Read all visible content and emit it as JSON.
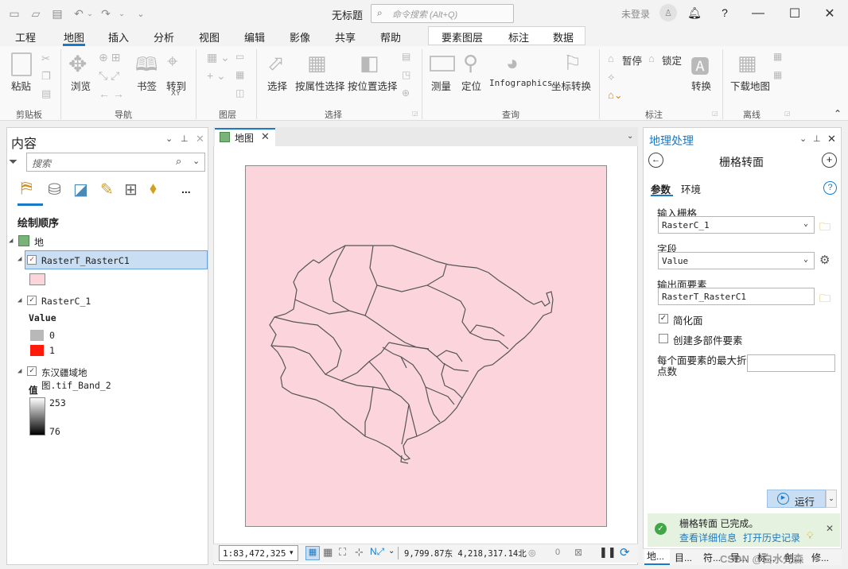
{
  "app": {
    "title": "无标题",
    "search_placeholder": "命令搜索 (Alt+Q)",
    "login": "未登录",
    "help": "?"
  },
  "ribbon_tabs": [
    "工程",
    "地图",
    "插入",
    "分析",
    "视图",
    "编辑",
    "影像",
    "共享",
    "帮助"
  ],
  "context_tabs": [
    "要素图层",
    "标注",
    "数据"
  ],
  "ribbon": {
    "paste": "粘贴",
    "browse": "浏览",
    "bookmarks": "书签",
    "goto": "转到",
    "goto_sub": "XY",
    "select": "选择",
    "select_attr": "按属性选择",
    "select_loc": "按位置选择",
    "measure": "测量",
    "locate": "定位",
    "infographics": "Infographics",
    "coord": "坐标转换",
    "pause": "暂停",
    "lock": "锁定",
    "convert": "转换",
    "download": "下载地图",
    "groups": [
      "剪贴板",
      "导航",
      "图层",
      "选择",
      "查询",
      "标注",
      "离线"
    ]
  },
  "contents": {
    "title": "内容",
    "search_placeholder": "搜索",
    "drawing_order": "绘制顺序",
    "map": "地图",
    "layer1": "RasterT_RasterC1",
    "layer2": "RasterC_1",
    "value_hdr": "Value",
    "v0": "0",
    "v1": "1",
    "layer3": "东汉疆域地图.tif_Band_2",
    "val_hdr": "值",
    "high": "253",
    "low": "76",
    "more": "..."
  },
  "map_tab": {
    "label": "地图"
  },
  "status": {
    "scale": "1:83,472,325",
    "coords": "9,799.87东 4,218,317.14北",
    "sel": "0"
  },
  "geoprocessing": {
    "title": "地理处理",
    "tool": "栅格转面",
    "tab_params": "参数",
    "tab_env": "环境",
    "in_raster_label": "输入栅格",
    "in_raster": "RasterC_1",
    "field_label": "字段",
    "field": "Value",
    "out_label": "输出面要素",
    "out": "RasterT_RasterC1",
    "simplify": "简化面",
    "multipart": "创建多部件要素",
    "maxv_label1": "每个面要素的最大折",
    "maxv_label2": "点数",
    "run": "运行",
    "done": "栅格转面 已完成。",
    "details": "查看详细信息",
    "history": "打开历史记录"
  },
  "bottom_tabs": [
    "地...",
    "目...",
    "符...",
    "导...",
    "标...",
    "创...",
    "修..."
  ],
  "watermark": "CSDN @白水先森",
  "colors": {
    "map_bg": "#fbd4dc",
    "accent": "#1a7ac7",
    "red": "#ff1a0a"
  }
}
